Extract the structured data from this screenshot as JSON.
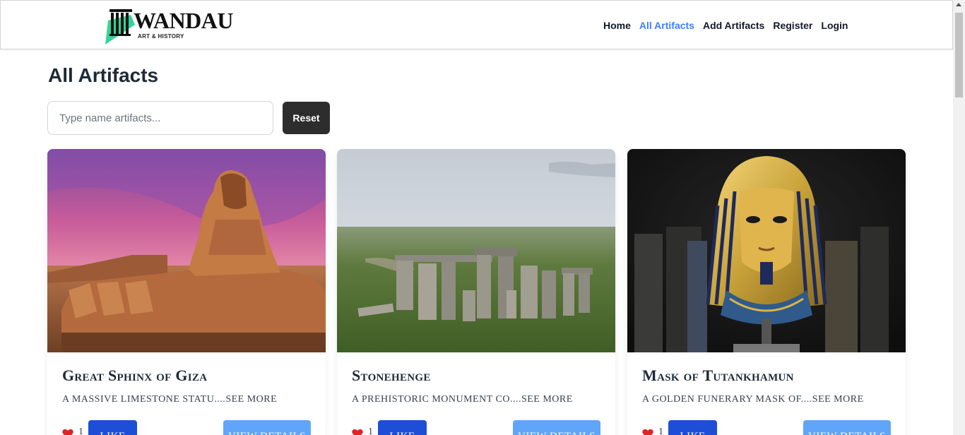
{
  "brand": {
    "name": "WANDAU",
    "tagline": "ART & HISTORY"
  },
  "nav": {
    "items": [
      {
        "label": "Home",
        "active": false
      },
      {
        "label": "All Artifacts",
        "active": true
      },
      {
        "label": "Add Artifacts",
        "active": false
      },
      {
        "label": "Register",
        "active": false
      },
      {
        "label": "Login",
        "active": false
      }
    ]
  },
  "page": {
    "title": "All Artifacts",
    "search_placeholder": "Type name artifacts...",
    "reset_label": "Reset"
  },
  "cards": [
    {
      "title": "Great Sphinx of Giza",
      "description": "A massive limestone statu....",
      "see_more": "see more",
      "likes": "1",
      "like_label": "Like",
      "details_label": "View Details",
      "image": "sphinx"
    },
    {
      "title": "Stonehenge",
      "description": "A prehistoric monument co....",
      "see_more": "see more",
      "likes": "1",
      "like_label": "Like",
      "details_label": "View Details",
      "image": "stonehenge"
    },
    {
      "title": "Mask of Tutankhamun",
      "description": "A golden funerary mask of....",
      "see_more": "see more",
      "likes": "1",
      "like_label": "Like",
      "details_label": "View Details",
      "image": "tutankhamun-mask"
    }
  ],
  "colors": {
    "active_nav": "#3b82f6",
    "like_button": "#1d4ed8",
    "details_button": "#60a5fa",
    "reset_button": "#2d2d2d",
    "heart": "#dc2626"
  }
}
